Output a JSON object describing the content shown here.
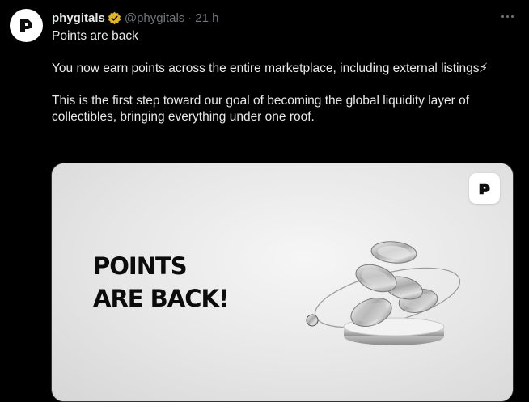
{
  "tweet": {
    "display_name": "phygitals",
    "handle": "@phygitals",
    "separator": "·",
    "time": "21 h",
    "verified_icon": "verified-badge-icon",
    "more_icon": "more-options-icon",
    "paragraphs": [
      "Points are back",
      "You now earn points across the entire marketplace, including external listings⚡",
      "This is the first step toward our goal of becoming the global liquidity layer of collectibles, bringing everything under one roof."
    ]
  },
  "media": {
    "headline_line1": "POINTS",
    "headline_line2": "ARE BACK!",
    "logo_icon": "phygitals-logo-icon",
    "illustration": "silver-coins-stack-illustration"
  },
  "colors": {
    "background": "#000000",
    "text": "#e7e9ea",
    "muted": "#71767b",
    "verified_gold": "#e2b719",
    "image_bg": "#ececec"
  }
}
